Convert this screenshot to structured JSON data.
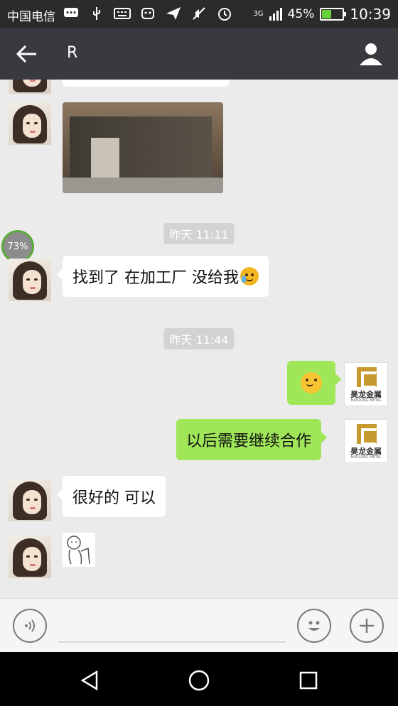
{
  "status_bar": {
    "carrier": "中国电信",
    "network": "3G",
    "battery_percent": "45%",
    "battery_level": 0.45,
    "time": "10:39",
    "icons": [
      "message-icon",
      "usb-icon",
      "keyboard-icon",
      "android-icon",
      "send-icon",
      "mute-icon",
      "alarm-icon",
      "signal-icon",
      "battery-icon"
    ]
  },
  "header": {
    "title": "R",
    "icons": {
      "back": "back-arrow-icon",
      "profile": "person-icon"
    }
  },
  "chat": {
    "progress_badge": "73%",
    "messages": [
      {
        "side": "left",
        "type": "image"
      },
      {
        "side": "system",
        "type": "timestamp",
        "text": "昨天 11:11"
      },
      {
        "side": "left",
        "type": "text",
        "text": "找到了 在加工厂 没给我",
        "emoji": "crying-laughing-emoji"
      },
      {
        "side": "system",
        "type": "timestamp",
        "text": "昨天 11:44"
      },
      {
        "side": "right",
        "type": "emoji",
        "emoji": "blushing-emoji"
      },
      {
        "side": "right",
        "type": "text",
        "text": "以后需要继续合作"
      },
      {
        "side": "left",
        "type": "text",
        "text": "很好的 可以"
      },
      {
        "side": "left",
        "type": "sticker"
      }
    ],
    "sender_logo_text": "昊龙金属",
    "sender_logo_sub": "HAOLONG METAL",
    "colors": {
      "sent_bubble": "#9fe658",
      "received_bubble": "#ffffff",
      "background": "#ebebeb",
      "header": "#393a3f"
    }
  },
  "input_bar": {
    "icons": {
      "voice": "voice-icon",
      "emoji": "smiley-icon",
      "more": "plus-icon"
    }
  },
  "nav_bar": {
    "icons": {
      "back": "triangle-back-icon",
      "home": "circle-home-icon",
      "recents": "square-recents-icon"
    }
  }
}
